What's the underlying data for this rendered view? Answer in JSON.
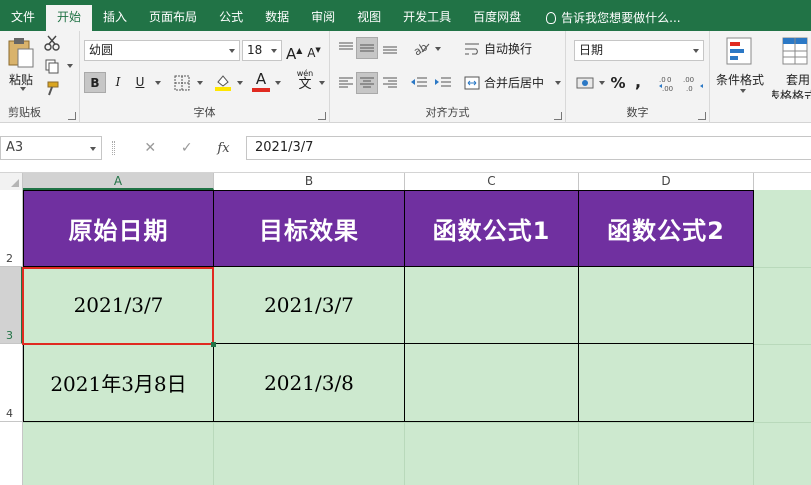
{
  "tabs": [
    {
      "label": "文件",
      "active": false
    },
    {
      "label": "开始",
      "active": true
    },
    {
      "label": "插入",
      "active": false
    },
    {
      "label": "页面布局",
      "active": false
    },
    {
      "label": "公式",
      "active": false
    },
    {
      "label": "数据",
      "active": false
    },
    {
      "label": "审阅",
      "active": false
    },
    {
      "label": "视图",
      "active": false
    },
    {
      "label": "开发工具",
      "active": false
    },
    {
      "label": "百度网盘",
      "active": false
    }
  ],
  "tell_me": "告诉我您想要做什么...",
  "ribbon": {
    "clipboard": {
      "group_label": "剪贴板",
      "paste_label": "粘贴"
    },
    "font": {
      "group_label": "字体",
      "font_name": "幼圆",
      "font_size": "18",
      "bold": "B",
      "italic": "I",
      "underline": "U",
      "grow": "A",
      "shrink": "A",
      "wen": "wén",
      "wen_char": "文"
    },
    "alignment": {
      "group_label": "对齐方式",
      "wrap_label": "自动换行",
      "merge_label": "合并后居中"
    },
    "number": {
      "group_label": "数字",
      "format": "日期",
      "percent": "%",
      "comma": ","
    },
    "styles": {
      "cond_format_label": "条件格式",
      "table_format_label": "套用",
      "table_format_label2": "表格格式"
    }
  },
  "formula_bar": {
    "name_box": "A3",
    "fx_label": "fx",
    "value": "2021/3/7"
  },
  "columns": [
    "A",
    "B",
    "C",
    "D"
  ],
  "selected_column": "A",
  "rows": [
    "2",
    "3",
    "4"
  ],
  "selected_row": "3",
  "table": {
    "headers": [
      "原始日期",
      "目标效果",
      "函数公式1",
      "函数公式2"
    ],
    "data": [
      [
        "2021/3/7",
        "2021/3/7",
        "",
        ""
      ],
      [
        "2021年3月8日",
        "2021/3/8",
        "",
        ""
      ]
    ]
  },
  "colors": {
    "ribbon_green": "#217346",
    "header_purple": "#7030a0",
    "cell_green": "#cde9cf",
    "selection_red": "#e02a20"
  }
}
